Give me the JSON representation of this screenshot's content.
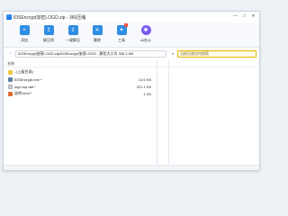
{
  "window": {
    "title": "IDSEncrypt加密LOGO.zip - 360压缩"
  },
  "window_controls": [
    "—",
    "□",
    "✕"
  ],
  "toolbar": {
    "items": [
      {
        "label": "添加",
        "icon": "add-icon",
        "color": "#2f8de4",
        "glyph": "+"
      },
      {
        "label": "解压到",
        "icon": "extract-icon",
        "color": "#2f8de4",
        "glyph": "↥"
      },
      {
        "label": "一键解压",
        "icon": "one-click-extract-icon",
        "color": "#2f8de4",
        "glyph": "⇪"
      },
      {
        "label": "删除",
        "icon": "delete-icon",
        "color": "#2f8de4",
        "glyph": "✕"
      },
      {
        "label": "工具",
        "icon": "tools-icon",
        "color": "#2f8de4",
        "glyph": "✦",
        "badge": "1"
      },
      {
        "label": "AI办公",
        "icon": "ai-office-icon",
        "color": "#7b5cf0",
        "glyph": "✺"
      }
    ]
  },
  "address": {
    "path": "IDSEncrypt加密LOGO.zip\\IDSEncrypt加密LOGO - 解包大小为 336.2 KB",
    "search_placeholder": "当前压缩包内搜索"
  },
  "list": {
    "header_name": "名称",
    "header_size": "",
    "rows": [
      {
        "name": "..(上级目录)",
        "size": "",
        "icon": "folder-up-icon",
        "color": "#f2c744"
      },
      {
        "name": "IDSEncrypt.exe *",
        "size": "13.6 KB",
        "icon": "exe-file-icon",
        "color": "#5b7fa6"
      },
      {
        "name": "logo.mp.dat *",
        "size": "321.1 KB",
        "icon": "dat-file-icon",
        "color": "#c7ccd3"
      },
      {
        "name": "说明.html *",
        "size": "1 KB",
        "icon": "html-file-icon",
        "color": "#e06b2f"
      }
    ]
  }
}
